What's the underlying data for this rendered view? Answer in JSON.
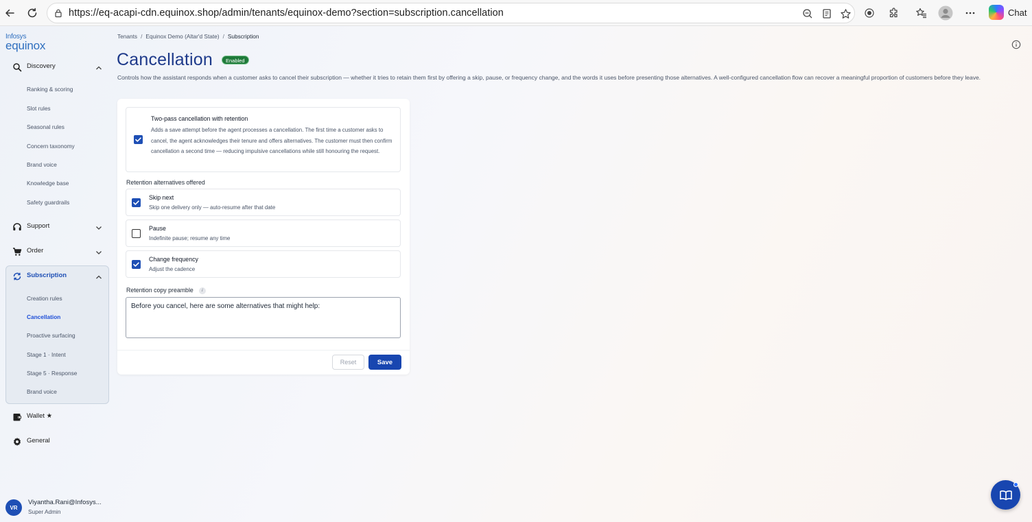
{
  "browser": {
    "url": "https://eq-acapi-cdn.equinox.shop/admin/tenants/equinox-demo?section=subscription.cancellation",
    "chat_label": "Chat"
  },
  "brand": {
    "line1": "Infosys",
    "line2": "equinox"
  },
  "sidebar": {
    "sections": [
      {
        "label": "Discovery",
        "icon": "search-icon"
      },
      {
        "label": "Support",
        "icon": "headset-icon"
      },
      {
        "label": "Order",
        "icon": "cart-icon"
      },
      {
        "label": "Subscription",
        "icon": "refresh-icon"
      },
      {
        "label": "Wallet ★",
        "icon": "wallet-icon"
      },
      {
        "label": "General",
        "icon": "gear-icon"
      }
    ],
    "discovery_items": [
      "Ranking & scoring",
      "Slot rules",
      "Seasonal rules",
      "Concern taxonomy",
      "Brand voice",
      "Knowledge base",
      "Safety guardrails"
    ],
    "subscription_items": [
      "Creation rules",
      "Cancellation",
      "Proactive surfacing",
      "Stage 1 · Intent",
      "Stage 5 · Response",
      "Brand voice"
    ]
  },
  "user": {
    "initials": "VR",
    "name": "Viyantha.Rani@Infosys...",
    "role": "Super Admin"
  },
  "breadcrumb": [
    "Tenants",
    "Equinox Demo (Altar'd State)",
    "Subscription"
  ],
  "page": {
    "title": "Cancellation",
    "badge": "Enabled",
    "description": "Controls how the assistant responds when a customer asks to cancel their subscription — whether it tries to retain them first by offering a skip, pause, or frequency change, and the words it uses before presenting those alternatives. A well-configured cancellation flow can recover a meaningful proportion of customers before they leave."
  },
  "two_pass": {
    "checked": true,
    "title": "Two-pass cancellation with retention",
    "description": "Adds a save attempt before the agent processes a cancellation. The first time a customer asks to cancel, the agent acknowledges their tenure and offers alternatives. The customer must then confirm cancellation a second time — reducing impulsive cancellations while still honouring the request."
  },
  "retention": {
    "label": "Retention alternatives offered",
    "options": [
      {
        "title": "Skip next",
        "desc": "Skip one delivery only — auto-resume after that date",
        "checked": true
      },
      {
        "title": "Pause",
        "desc": "Indefinite pause; resume any time",
        "checked": false
      },
      {
        "title": "Change frequency",
        "desc": "Adjust the cadence",
        "checked": true
      }
    ]
  },
  "preamble": {
    "label": "Retention copy preamble",
    "info": "i",
    "value": "Before you cancel, here are some alternatives that might help:"
  },
  "actions": {
    "reset": "Reset",
    "save": "Save"
  },
  "colors": {
    "accent": "#1846b0",
    "badge": "#1f7a3a",
    "title": "#1e3a8a"
  }
}
